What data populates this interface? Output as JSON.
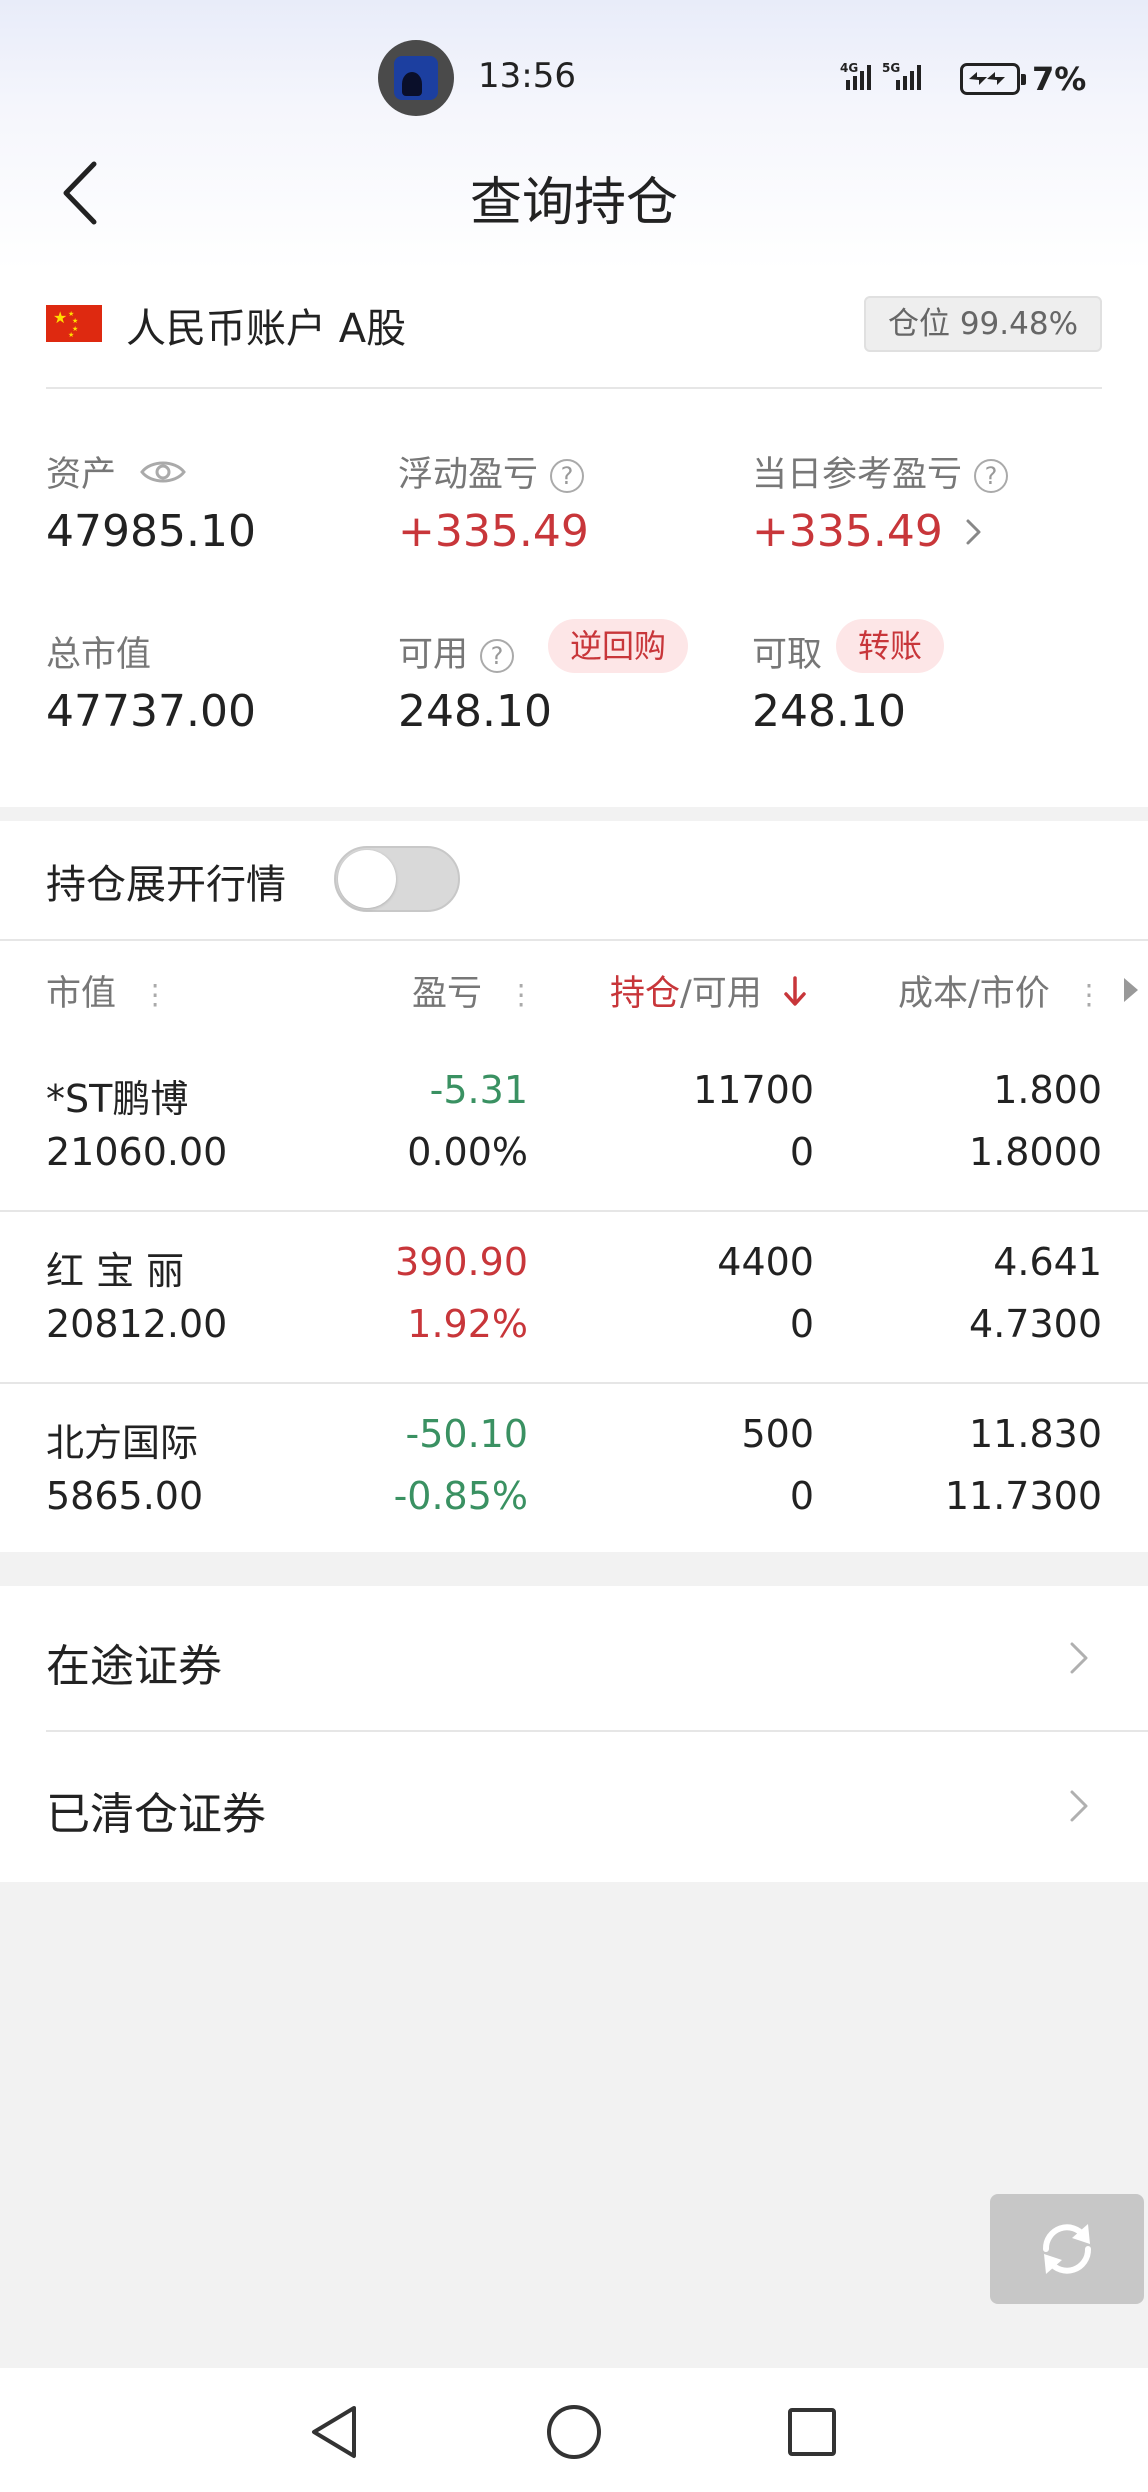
{
  "status_bar": {
    "time": "13:56",
    "network_1": "4G",
    "network_2": "5G",
    "battery": "7%"
  },
  "header": {
    "title": "查询持仓"
  },
  "account": {
    "name": "人民币账户 A股",
    "position_ratio": "仓位 99.48%"
  },
  "summary": {
    "assets_label": "资产",
    "assets_value": "47985.10",
    "floating_pl_label": "浮动盈亏",
    "floating_pl_value": "+335.49",
    "daily_pl_label": "当日参考盈亏",
    "daily_pl_value": "+335.49",
    "market_value_label": "总市值",
    "market_value_value": "47737.00",
    "available_label": "可用",
    "available_tag": "逆回购",
    "available_value": "248.10",
    "withdrawable_label": "可取",
    "withdrawable_tag": "转账",
    "withdrawable_value": "248.10"
  },
  "toggle": {
    "label": "持仓展开行情",
    "on": false
  },
  "table": {
    "columns": {
      "market_value": "市值",
      "profit_loss": "盈亏",
      "holding_red": "持仓",
      "holding_rest": "/可用",
      "cost_price": "成本/市价"
    },
    "rows": [
      {
        "name": "*ST鹏博",
        "market_value": "21060.00",
        "pl": "-5.31",
        "pl_pct": "0.00%",
        "pl_color": "green",
        "pct_color": "black",
        "holding": "11700",
        "available": "0",
        "cost": "1.800",
        "price": "1.8000"
      },
      {
        "name": "红 宝 丽",
        "market_value": "20812.00",
        "pl": "390.90",
        "pl_pct": "1.92%",
        "pl_color": "red",
        "pct_color": "red",
        "holding": "4400",
        "available": "0",
        "cost": "4.641",
        "price": "4.7300"
      },
      {
        "name": "北方国际",
        "market_value": "5865.00",
        "pl": "-50.10",
        "pl_pct": "-0.85%",
        "pl_color": "green",
        "pct_color": "green",
        "holding": "500",
        "available": "0",
        "cost": "11.830",
        "price": "11.7300"
      }
    ]
  },
  "menu": {
    "in_transit": "在途证券",
    "cleared": "已清仓证券"
  },
  "colors": {
    "up_red": "#c8363a",
    "down_green": "#3a9162",
    "label_gray": "#777777"
  }
}
